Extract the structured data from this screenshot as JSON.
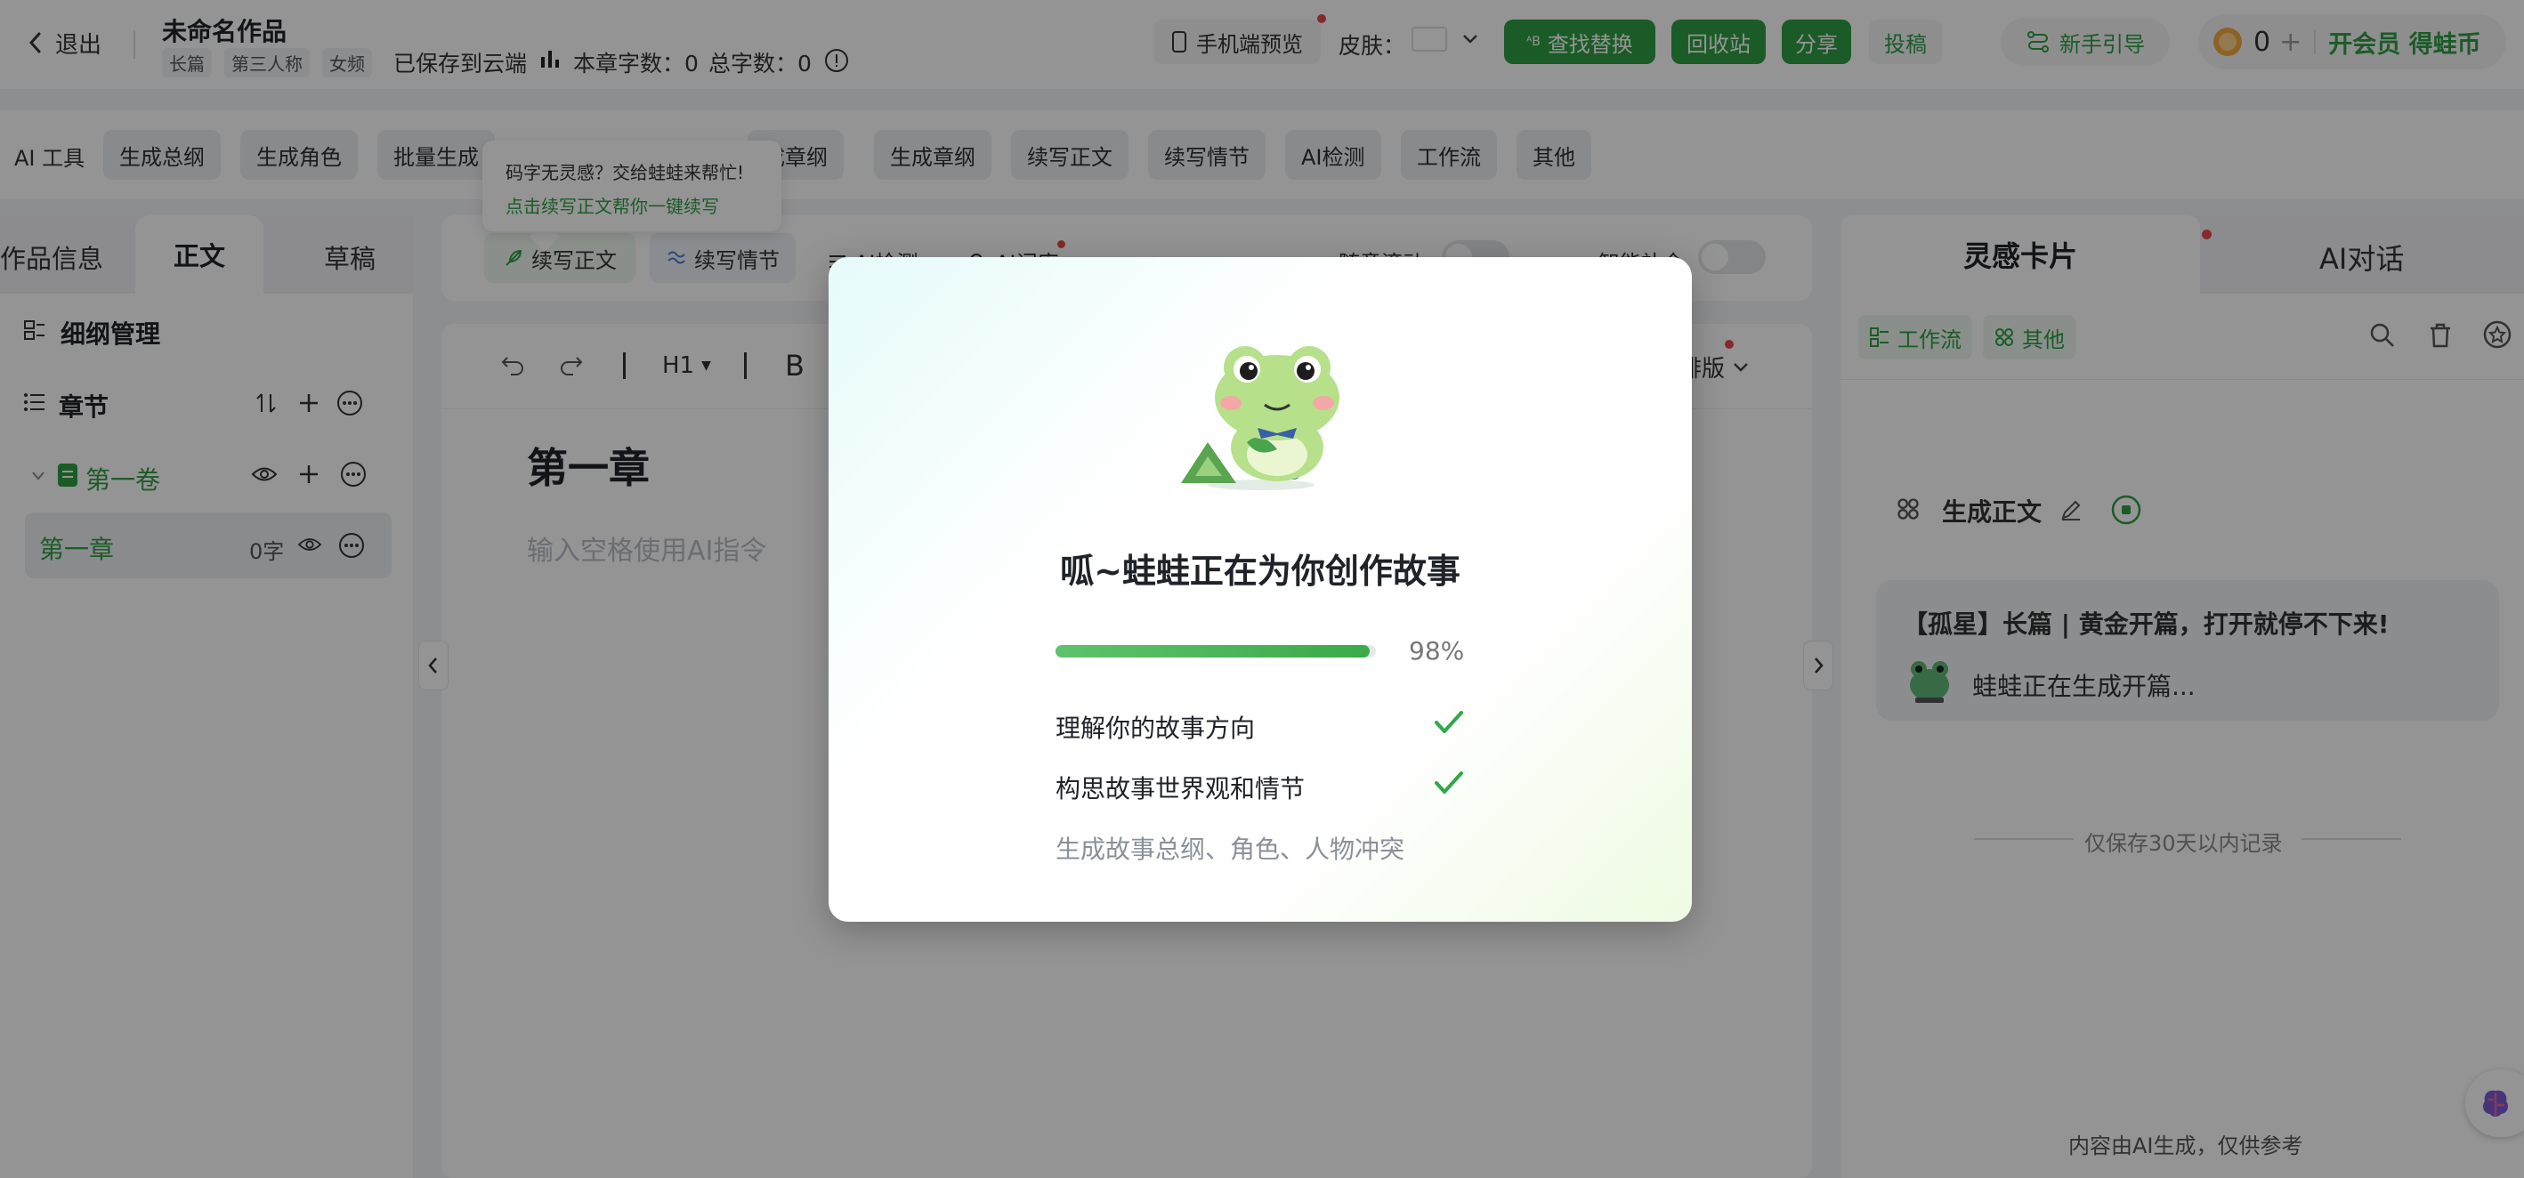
{
  "header": {
    "back_label": "退出",
    "work_title": "未命名作品",
    "tags": [
      "长篇",
      "第三人称",
      "女频"
    ],
    "save_status": "已保存到云端",
    "chapter_words_label": "本章字数：0",
    "total_words_label": "总字数：0",
    "mobile_preview": "手机端预览",
    "skin_label": "皮肤：",
    "find_replace": "查找替换",
    "recycle": "回收站",
    "share": "分享",
    "submit": "投稿",
    "guide": "新手引导",
    "coin_count": "0",
    "vip_label": "开会员 得蛙币"
  },
  "ai_toolbar": {
    "label": "AI 工具",
    "items": [
      "生成总纲",
      "生成角色",
      "批量生成",
      "成章纲",
      "生成章纲",
      "续写正文",
      "续写情节",
      "AI检测",
      "工作流",
      "其他"
    ]
  },
  "tooltip": {
    "title": "码字无灵感？交给蛙蛙来帮忙!",
    "link": "点击续写正文帮你一键续写"
  },
  "left_panel": {
    "tabs": [
      "作品信息",
      "正文",
      "草稿"
    ],
    "outline_title": "细纲管理",
    "chapters_title": "章节",
    "volume_name": "第一卷",
    "chapter_name": "第一章",
    "chapter_words": "0字"
  },
  "editor": {
    "continue_text": "续写正文",
    "continue_plot": "续写情节",
    "ai_detect": "AI检测",
    "ai_lexicon": "AI词库",
    "scroll_label": "随意滚动",
    "hint_label": "智能补全",
    "heading_select": "H1",
    "bold": "B",
    "layout_label": "排版",
    "chapter_title": "第一章",
    "placeholder": "输入空格使用AI指令"
  },
  "right_panel": {
    "tabs": [
      "灵感卡片",
      "AI对话"
    ],
    "chips": [
      "工作流",
      "其他"
    ],
    "card_title": "生成正文",
    "message_title": "【孤星】长篇 | 黄金开篇，打开就停不下来!",
    "message_status": "蛙蛙正在生成开篇...",
    "history_note": "仅保存30天以内记录",
    "footer_note": "内容由AI生成，仅供参考"
  },
  "modal": {
    "title": "呱~蛙蛙正在为你创作故事",
    "progress": 98,
    "progress_label": "98%",
    "steps": [
      {
        "label": "理解你的故事方向",
        "done": true
      },
      {
        "label": "构思故事世界观和情节",
        "done": true
      },
      {
        "label": "生成故事总纲、角色、人物冲突",
        "done": false
      }
    ]
  },
  "colors": {
    "brand_green": "#26a33d",
    "progress_start": "#5ec36c",
    "progress_end": "#3aaa4a",
    "check_green": "#2fa84a"
  }
}
